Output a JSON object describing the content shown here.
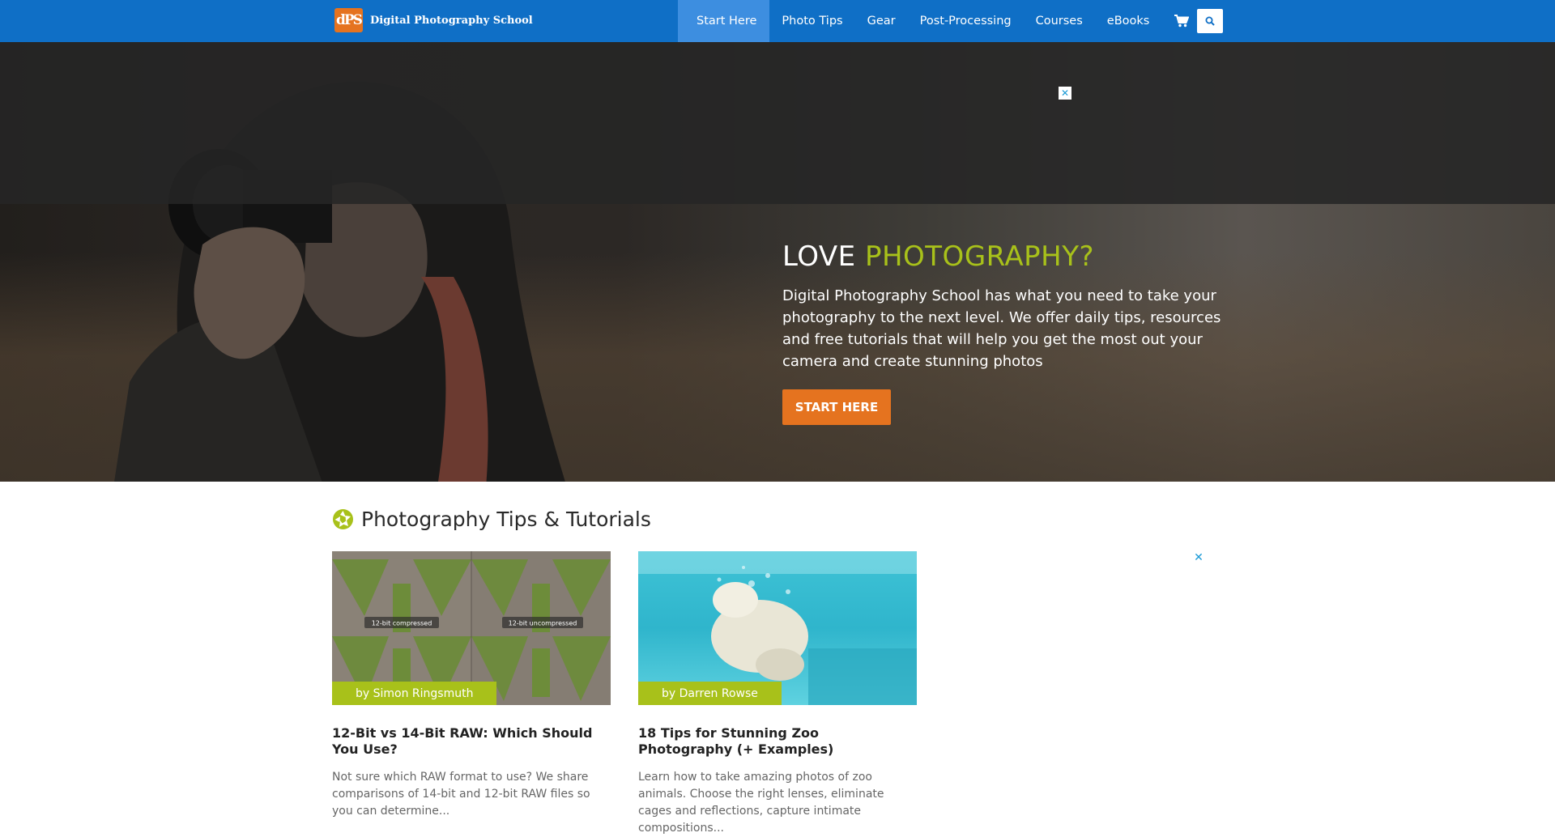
{
  "header": {
    "logo_mark": "dPS",
    "logo_text": "Digital Photography School",
    "nav": [
      {
        "label": "Start Here",
        "active": true
      },
      {
        "label": "Photo Tips"
      },
      {
        "label": "Gear"
      },
      {
        "label": "Post-Processing"
      },
      {
        "label": "Courses"
      },
      {
        "label": "eBooks"
      }
    ],
    "cart_icon": "cart-icon",
    "search_icon": "search-icon"
  },
  "hero": {
    "title_plain": "LOVE ",
    "title_accent": "PHOTOGRAPHY?",
    "description": "Digital Photography School has what you need to take your photography to the next level. We offer daily tips, resources and free tutorials that will help you get the most out your camera and create stunning photos",
    "cta_label": "START HERE",
    "ad_close": "✕"
  },
  "tips": {
    "title": "Photography Tips & Tutorials",
    "icon": "aperture-icon",
    "cards": [
      {
        "author": "by Simon Ringsmuth",
        "image_labels": [
          "12-bit compressed",
          "12-bit uncompressed"
        ],
        "title": "12-Bit vs 14-Bit RAW: Which Should You Use?",
        "excerpt": "Not sure which RAW format to use? We share comparisons of 14-bit and 12-bit RAW files so you can determine..."
      },
      {
        "author": "by Darren Rowse",
        "title": "18 Tips for Stunning Zoo Photography (+ Examples)",
        "excerpt": "Learn how to take amazing photos of zoo animals. Choose the right lenses, eliminate cages and reflections, capture intimate compositions..."
      }
    ],
    "ad_close": "✕"
  },
  "colors": {
    "nav_blue": "#0f6fc6",
    "accent_green": "#a8c11a",
    "cta_orange": "#e5731f"
  }
}
